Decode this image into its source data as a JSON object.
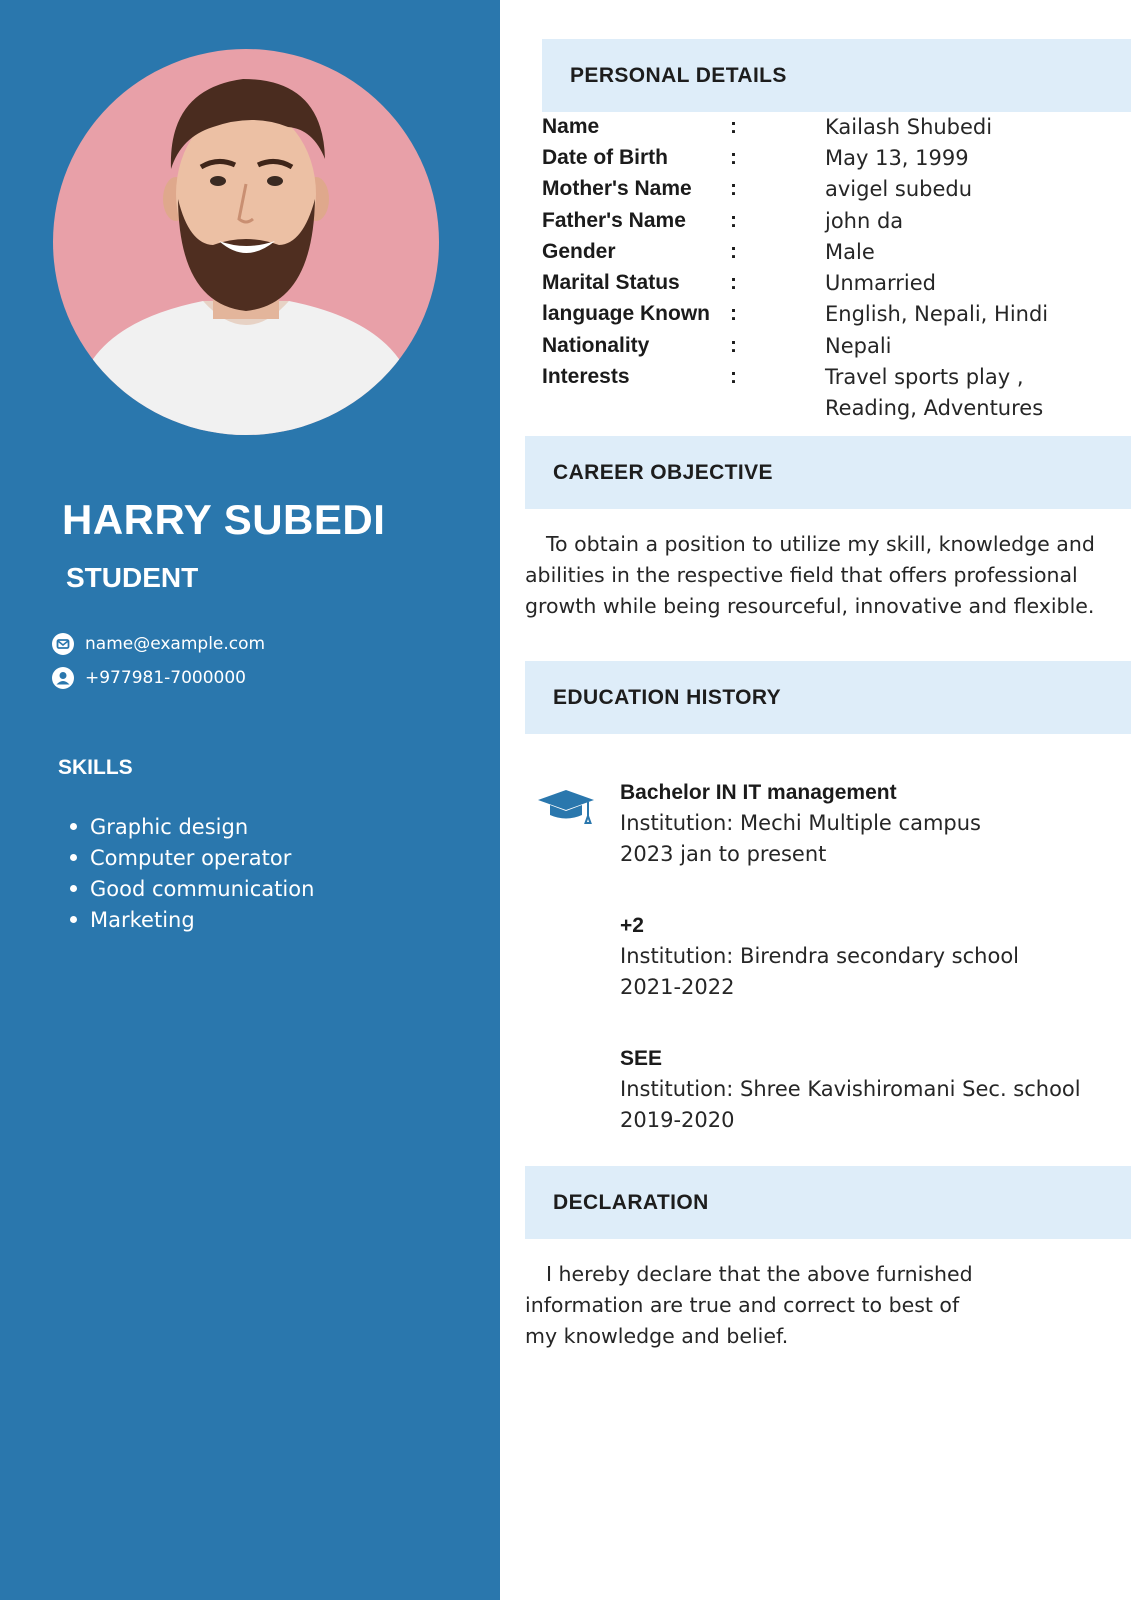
{
  "profile": {
    "name": "HARRY SUBEDI",
    "role": "STUDENT",
    "email": "name@example.com",
    "phone": "+977981-7000000"
  },
  "skills": {
    "title": "SKILLS",
    "items": [
      "Graphic design",
      "Computer operator",
      "Good communication",
      "Marketing"
    ]
  },
  "personal_details": {
    "title": "PERSONAL DETAILS",
    "rows": [
      {
        "label": "Name",
        "value": "Kailash Shubedi"
      },
      {
        "label": "Date of Birth",
        "value": "May 13, 1999"
      },
      {
        "label": "Mother's Name",
        "value": "avigel subedu"
      },
      {
        "label": "Father's Name",
        "value": "john da"
      },
      {
        "label": "Gender",
        "value": "Male"
      },
      {
        "label": "Marital Status",
        "value": "Unmarried"
      },
      {
        "label": "language Known",
        "value": "English, Nepali, Hindi"
      },
      {
        "label": "Nationality",
        "value": "Nepali"
      },
      {
        "label": "Interests",
        "value": "Travel sports play ,",
        "value_cont": "Reading, Adventures"
      }
    ],
    "separator": ":"
  },
  "career_objective": {
    "title": "CAREER OBJECTIVE",
    "text": "To obtain a position to utilize my skill, knowledge and abilities in the respective field that offers professional growth while being resourceful, innovative and flexible."
  },
  "education": {
    "title": "EDUCATION HISTORY",
    "entries": [
      {
        "degree": "Bachelor IN IT management",
        "institution": "Institution: Mechi Multiple campus",
        "period": "2023 jan to present"
      },
      {
        "degree": "+2",
        "institution": "Institution: Birendra secondary school",
        "period": "2021-2022"
      },
      {
        "degree": "SEE",
        "institution": "Institution: Shree Kavishiromani  Sec. school",
        "period": "2019-2020"
      }
    ]
  },
  "declaration": {
    "title": "DECLARATION",
    "text": "I hereby declare that the above furnished information are true and correct to best of my knowledge and belief."
  },
  "colors": {
    "sidebar": "#2a77ad",
    "band": "#deedf9",
    "photo_background": "#e8a0a8"
  },
  "icons": {
    "email": "mail-icon",
    "phone": "user-circle-icon",
    "education": "graduation-cap-icon"
  }
}
